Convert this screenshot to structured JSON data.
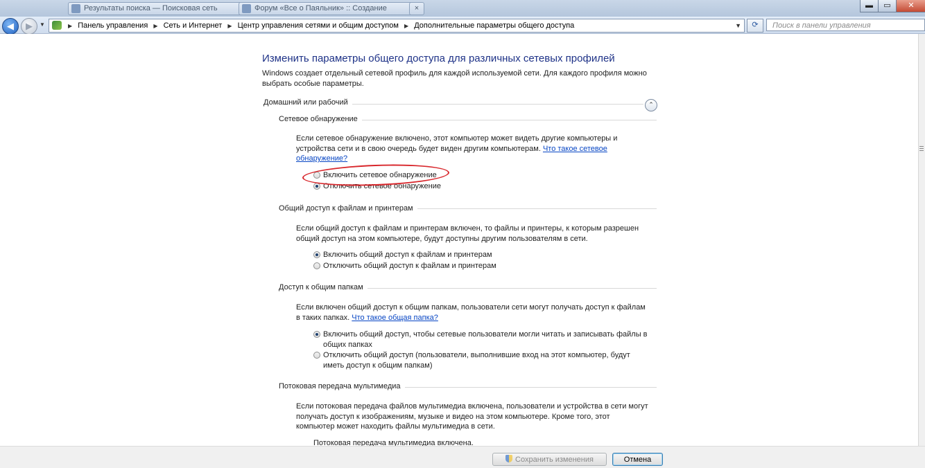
{
  "titlebar": {
    "tabs": [
      {
        "label": "Результаты поиска — Поисковая сеть"
      },
      {
        "label": "Форум «Все о Паяльник» :: Создание"
      }
    ],
    "minimize": "▬",
    "maximize": "▭",
    "close": "✕"
  },
  "address": {
    "back": "◀",
    "forward": "▶",
    "breadcrumbs": [
      "Панель управления",
      "Сеть и Интернет",
      "Центр управления сетями и общим доступом",
      "Дополнительные параметры общего доступа"
    ],
    "search_placeholder": "Поиск в панели управления"
  },
  "page": {
    "heading": "Изменить параметры общего доступа для различных сетевых профилей",
    "intro": "Windows создает отдельный сетевой профиль для каждой используемой сети. Для каждого профиля можно выбрать особые параметры.",
    "profile_title": "Домашний или рабочий",
    "collapse_icon": "⌃"
  },
  "sections": {
    "discovery": {
      "title": "Сетевое обнаружение",
      "desc": "Если сетевое обнаружение включено, этот компьютер может видеть другие компьютеры и устройства сети и в свою очередь будет виден другим компьютерам.",
      "link": "Что такое сетевое обнаружение?",
      "opt_on": "Включить сетевое обнаружение",
      "opt_off": "Отключить сетевое обнаружение"
    },
    "file_sharing": {
      "title": "Общий доступ к файлам и принтерам",
      "desc": "Если общий доступ к файлам и принтерам включен, то файлы и принтеры, к которым разрешен общий доступ на этом компьютере, будут доступны другим пользователям в сети.",
      "opt_on": "Включить общий доступ к файлам и принтерам",
      "opt_off": "Отключить общий доступ к файлам и принтерам"
    },
    "public_folders": {
      "title": "Доступ к общим папкам",
      "desc": "Если включен общий доступ к общим папкам, пользователи сети могут получать доступ к файлам в таких папках.",
      "link": "Что такое общая папка?",
      "opt_on": "Включить общий доступ, чтобы сетевые пользователи могли читать и записывать файлы в общих папках",
      "opt_off": "Отключить общий доступ (пользователи, выполнившие вход на этот компьютер, будут иметь доступ к общим папкам)"
    },
    "media": {
      "title": "Потоковая передача мультимедиа",
      "desc": "Если потоковая передача файлов мультимедиа включена, пользователи и устройства в сети могут получать доступ к изображениям, музыке и видео на этом компьютере. Кроме того, этот компьютер может находить файлы мультимедиа в сети.",
      "status": "Потоковая передача мультимедиа включена."
    }
  },
  "footer": {
    "save": "Сохранить изменения",
    "cancel": "Отмена"
  }
}
